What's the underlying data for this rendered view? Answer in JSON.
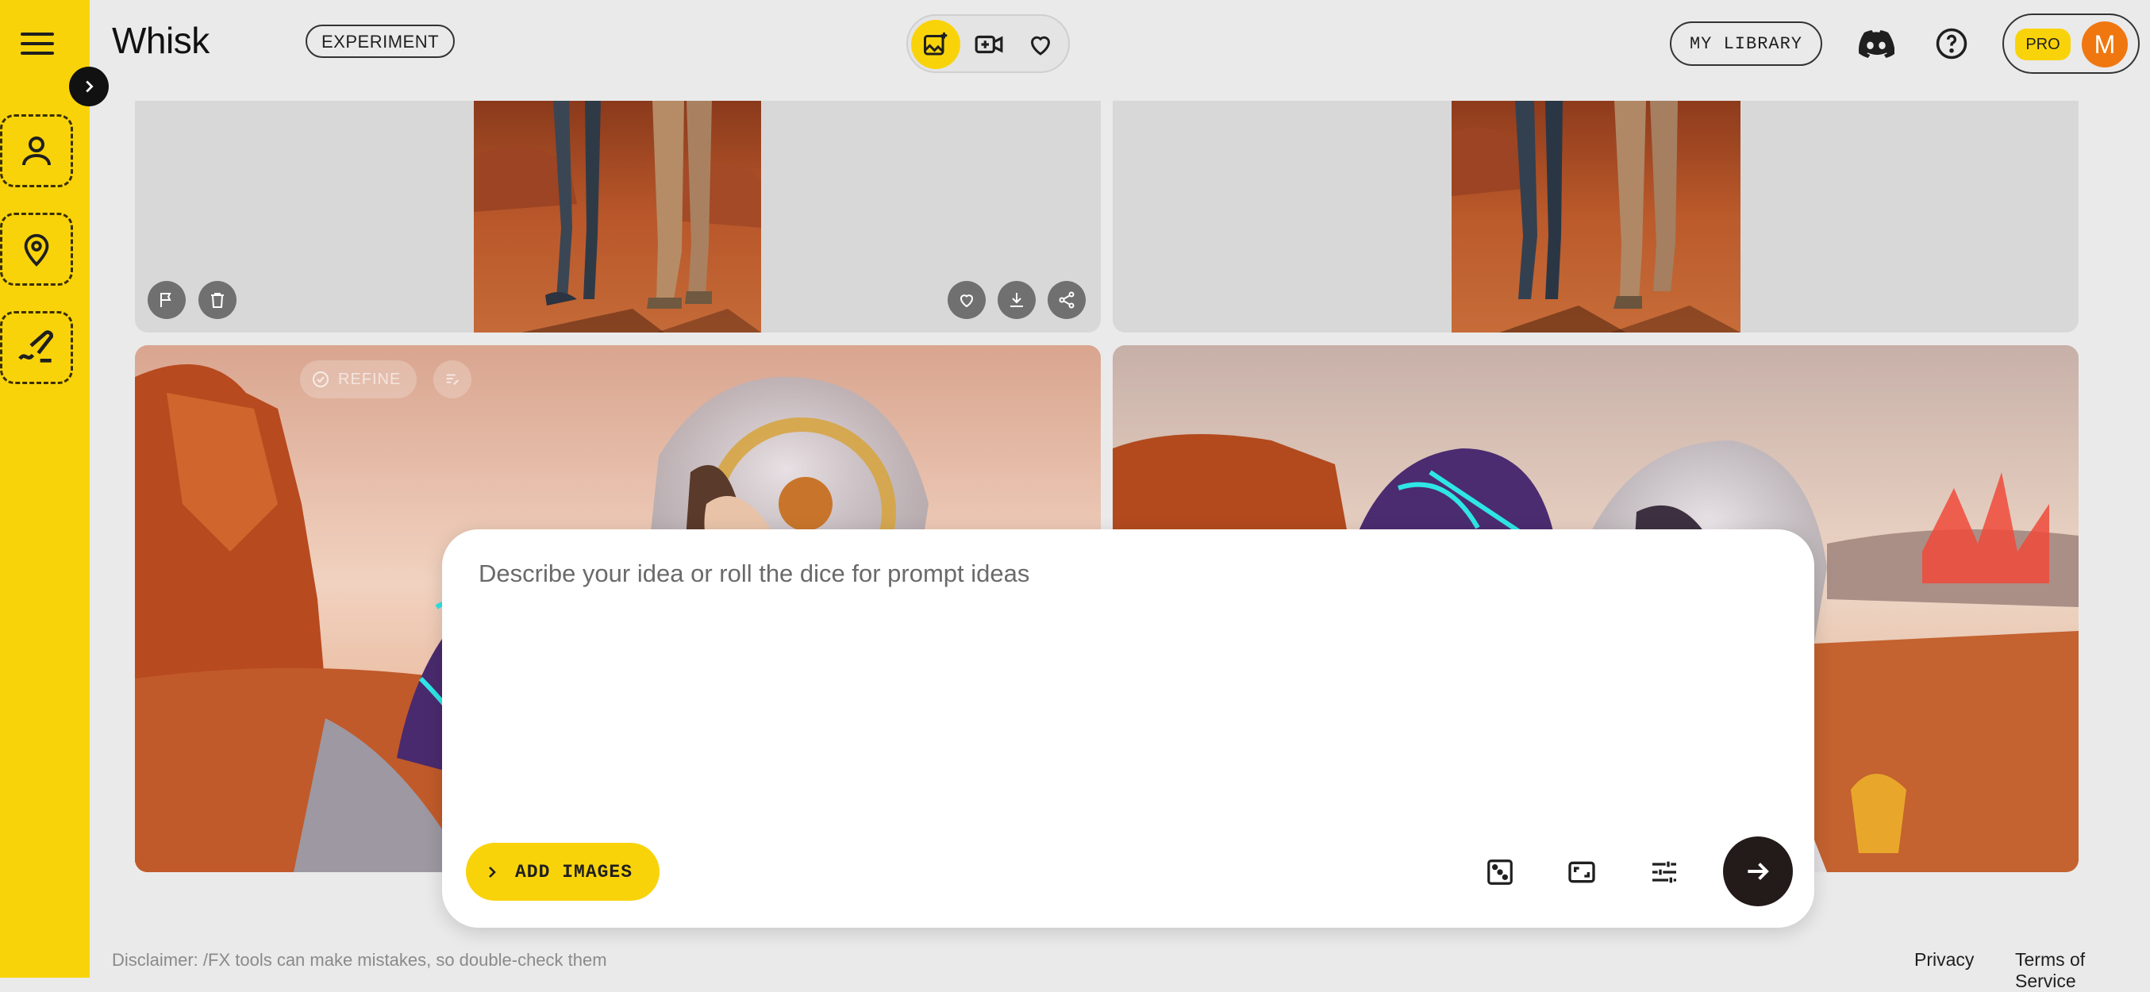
{
  "app": {
    "brand": "Whisk",
    "badge": "EXPERIMENT"
  },
  "header": {
    "library_label": "MY LIBRARY",
    "plan_badge": "PRO",
    "avatar_initial": "M",
    "modes": [
      {
        "name": "image-create",
        "icon": "image-sparkle-icon",
        "active": true
      },
      {
        "name": "video",
        "icon": "video-plus-icon",
        "active": false
      },
      {
        "name": "favorites",
        "icon": "heart-icon",
        "active": false
      }
    ],
    "icons": [
      "discord-icon",
      "help-icon"
    ]
  },
  "sidebar": {
    "menu_icon": "hamburger-menu-icon",
    "expand_icon": "chevron-right-icon",
    "slots": [
      {
        "name": "subject",
        "icon": "person-icon"
      },
      {
        "name": "scene",
        "icon": "location-pin-icon"
      },
      {
        "name": "style",
        "icon": "brush-icon"
      }
    ]
  },
  "gallery": {
    "top_actions_left": [
      "flag-icon",
      "trash-icon"
    ],
    "top_actions_right": [
      "heart-icon",
      "download-icon",
      "share-icon"
    ],
    "refine_label": "REFINE"
  },
  "prompt": {
    "placeholder": "Describe your idea or roll the dice for prompt ideas",
    "value": "",
    "add_images_label": "ADD IMAGES",
    "tools": [
      "dice-icon",
      "aspect-ratio-icon",
      "settings-sliders-icon"
    ],
    "submit_icon": "arrow-right-icon"
  },
  "footer": {
    "disclaimer": "Disclaimer: /FX tools can make mistakes, so double-check them",
    "links": [
      "Privacy",
      "Terms of Service"
    ]
  },
  "colors": {
    "accent": "#f9d30a",
    "background": "#eaeaea",
    "avatar": "#f0770f",
    "submit": "#231a1a"
  }
}
